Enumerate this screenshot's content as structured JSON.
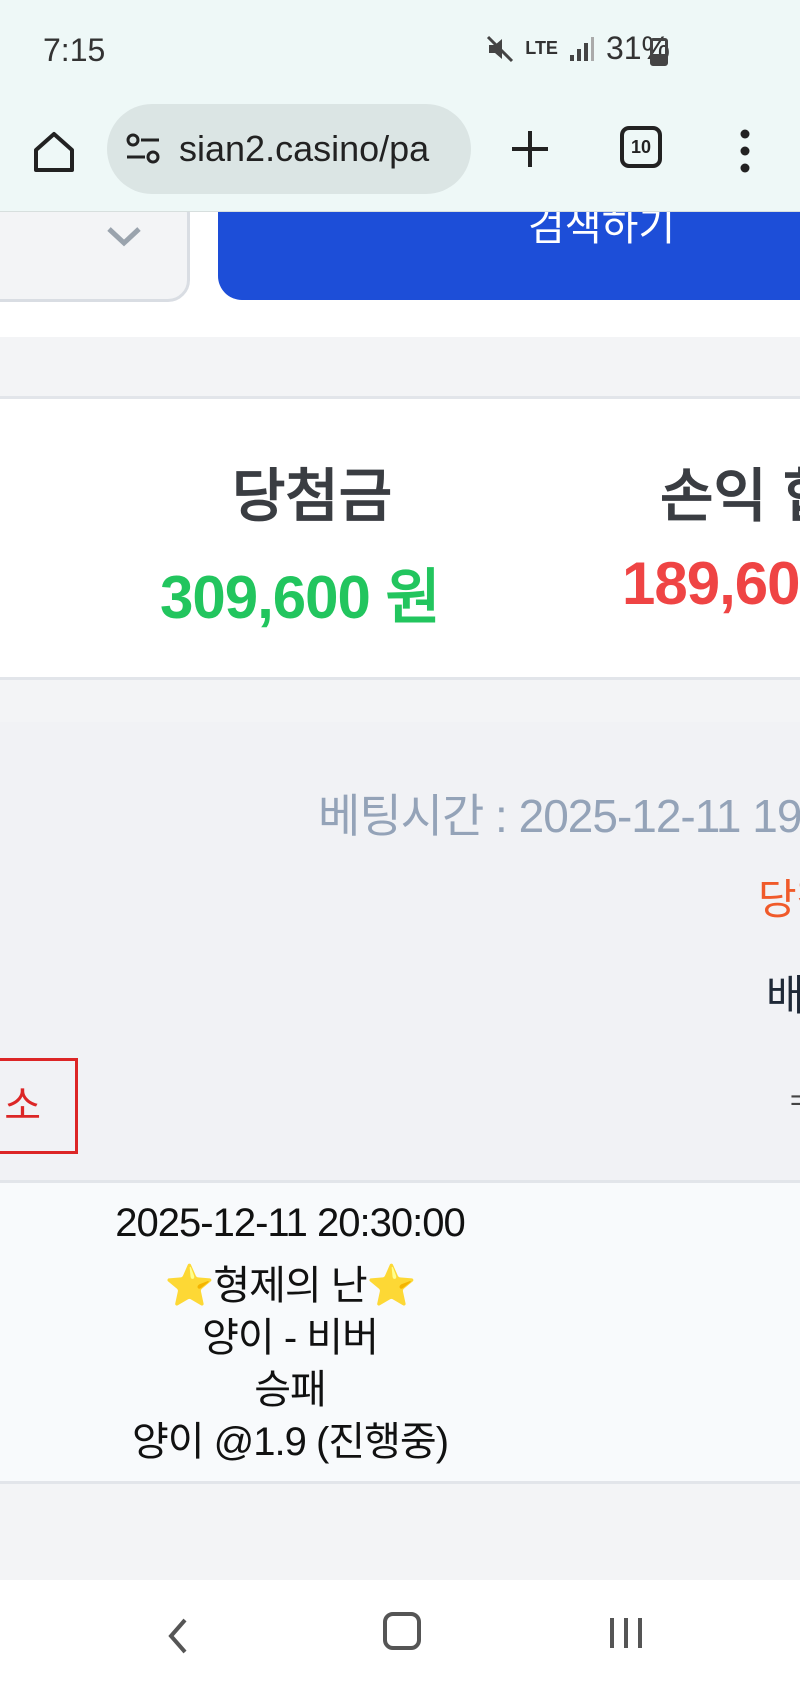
{
  "status_bar": {
    "time": "7:15",
    "network": "LTE",
    "battery": "31%"
  },
  "browser": {
    "url": "sian2.casino/pa",
    "tab_count": "10"
  },
  "search": {
    "button_label": "검색하기"
  },
  "summary": {
    "winnings_label": "당첨금",
    "winnings_value": "309,600 원",
    "profit_label": "손익 합",
    "profit_value": "189,60"
  },
  "bet": {
    "time_label": "베팅시간 : 2025-12-11 19",
    "status": "당첨",
    "amount_label": "배",
    "small_text": "=",
    "cancel_label": "취소",
    "detail": {
      "datetime": "2025-12-11 20:30:00",
      "league": "⭐형제의 난⭐",
      "match": "양이 - 비버",
      "market": "승패",
      "pick": "양이 @1.9 (진행중)"
    }
  },
  "colors": {
    "primary": "#1d4ed8",
    "win_green": "#22c55e",
    "loss_red": "#ef4444",
    "status_orange": "#f05a2a"
  }
}
